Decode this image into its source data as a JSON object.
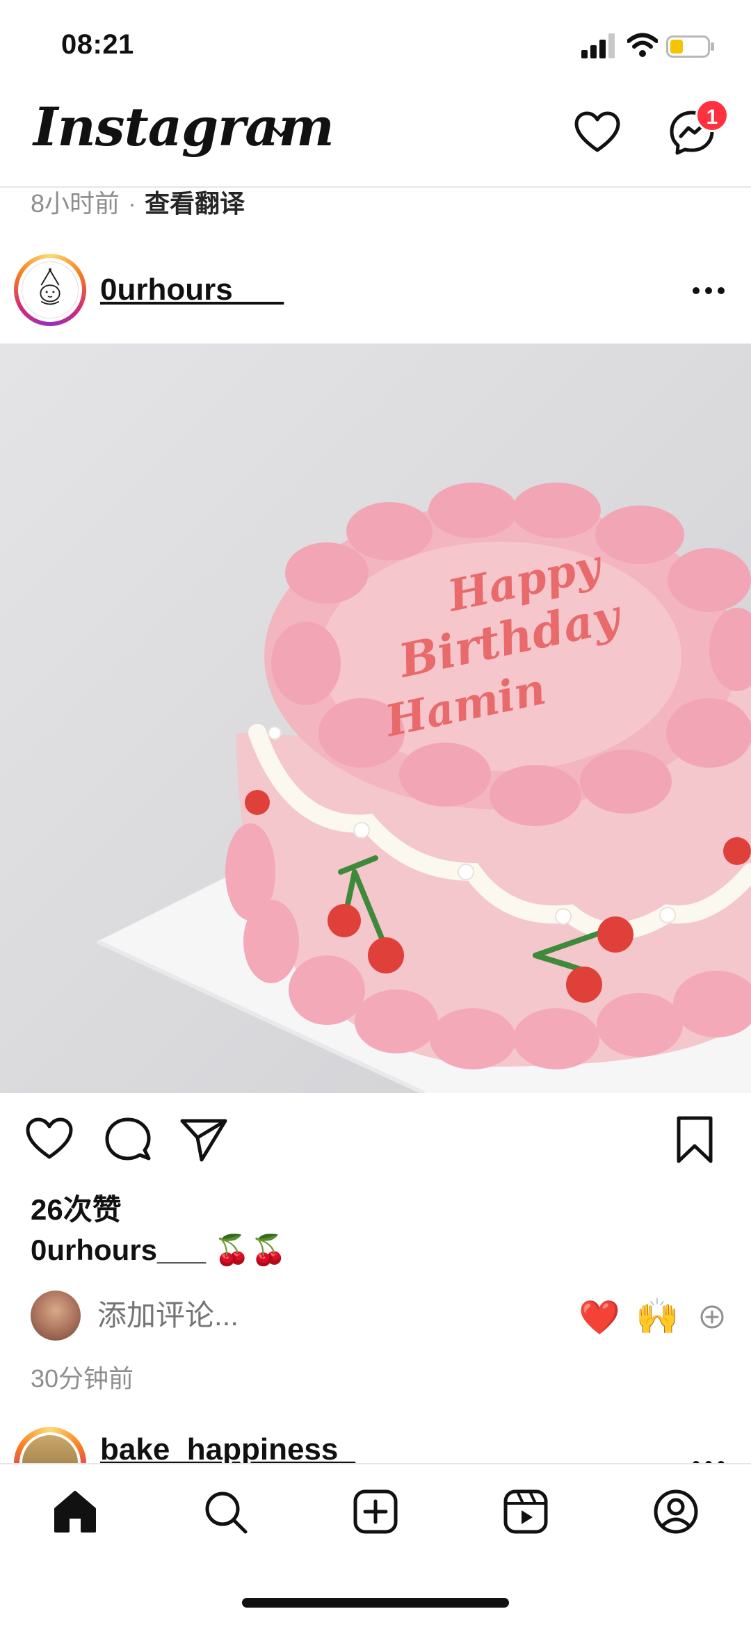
{
  "status_bar": {
    "time": "08:21",
    "signal_icon": "cellular-signal-icon",
    "wifi_icon": "wifi-icon",
    "battery_icon": "battery-low-icon",
    "battery_color": "#f5c400"
  },
  "header": {
    "logo_text": "Instagram",
    "chevron_icon": "chevron-down-icon",
    "heart_icon": "heart-outline-icon",
    "messenger_icon": "messenger-icon",
    "message_badge": "1",
    "badge_color": "#ff3040"
  },
  "previous_post": {
    "time_ago": "8小时前",
    "separator": "·",
    "translate_label": "查看翻译"
  },
  "post": {
    "username": "0urhours___",
    "more_icon": "more-horizontal-icon",
    "image_alt": "Pink cherry birthday cake",
    "cake_text_lines": [
      "Happy",
      "Birthday",
      "Hamin"
    ],
    "like_icon": "heart-outline-icon",
    "comment_icon": "comment-bubble-icon",
    "share_icon": "paper-plane-icon",
    "save_icon": "bookmark-icon",
    "likes_text": "26次赞",
    "caption_user": "0urhours___",
    "caption_text": "🍒🍒",
    "comment_placeholder": "添加评论...",
    "quick_reaction_1": "❤️",
    "quick_reaction_2": "🙌",
    "add_reaction_icon": "add-circle-icon",
    "time_ago": "30分钟前"
  },
  "next_post": {
    "username": "bake_happiness_"
  },
  "bottom_nav": {
    "items": [
      {
        "icon": "home-icon"
      },
      {
        "icon": "search-icon"
      },
      {
        "icon": "create-icon"
      },
      {
        "icon": "reels-icon"
      },
      {
        "icon": "profile-icon"
      }
    ]
  },
  "colors": {
    "cake_pink": "#f4b6c2",
    "icing_red": "#e86a6a",
    "cherry_red": "#e0403a",
    "stem_green": "#3f8a3a"
  }
}
